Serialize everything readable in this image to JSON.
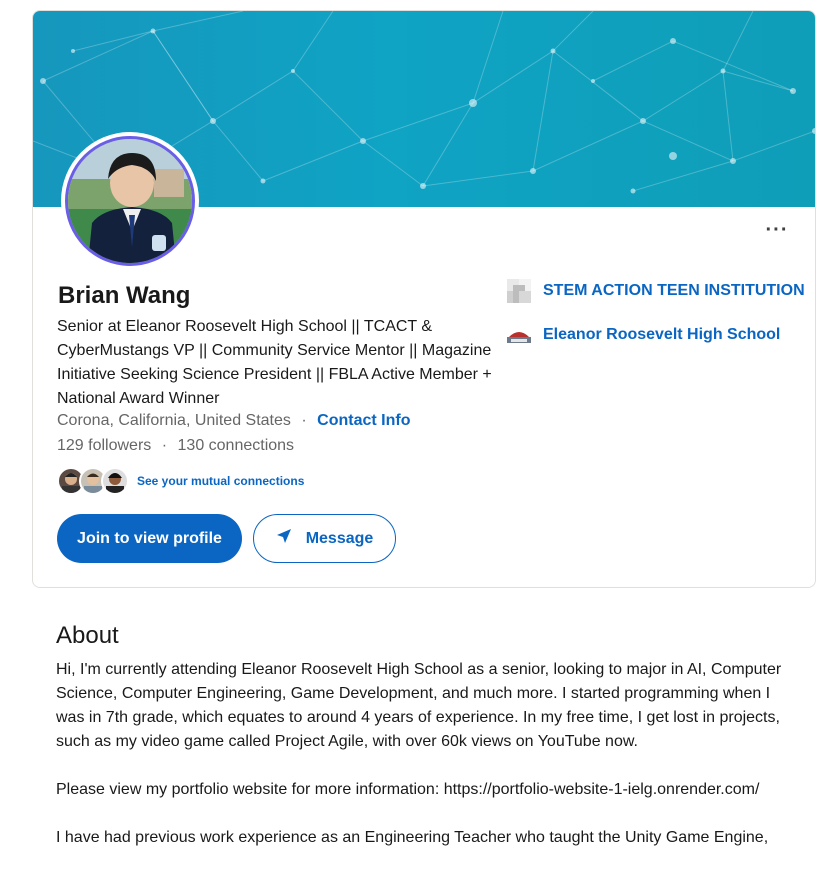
{
  "profile": {
    "name": "Brian Wang",
    "headline": "Senior at Eleanor Roosevelt High School || TCACT & CyberMustangs VP || Community Service Mentor || Magazine Initiative Seeking Science President || FBLA Active Member + National Award Winner",
    "location": "Corona, California, United States",
    "separator": "·",
    "contact_info": "Contact Info",
    "followers": "129 followers",
    "connections": "130 connections",
    "mutual_connections": "See your mutual connections",
    "more_label": "···"
  },
  "buttons": {
    "join": "Join to view profile",
    "message": "Message"
  },
  "organizations": [
    {
      "name": "STEM ACTION TEEN INSTITUTION",
      "icon": "org-logo-placeholder-icon"
    },
    {
      "name": "Eleanor Roosevelt High School",
      "icon": "school-logo-icon"
    }
  ],
  "about": {
    "title": "About",
    "paragraphs": [
      "Hi, I'm currently attending Eleanor Roosevelt High School as a senior, looking to major in AI, Computer Science, Computer Engineering, Game Development, and much more. I started programming when I was in 7th grade, which equates to around 4 years of experience. In my free time, I get lost in projects, such as my video game called Project Agile, with over 60k views on YouTube now.",
      "Please view my portfolio website for more information: https://portfolio-website-1-ielg.onrender.com/",
      "I have had previous work experience as an Engineering Teacher who taught the Unity Game Engine,"
    ]
  },
  "colors": {
    "link": "#0a66c2",
    "banner": "#119fc0",
    "avatar_ring": "#6a5ee6"
  }
}
